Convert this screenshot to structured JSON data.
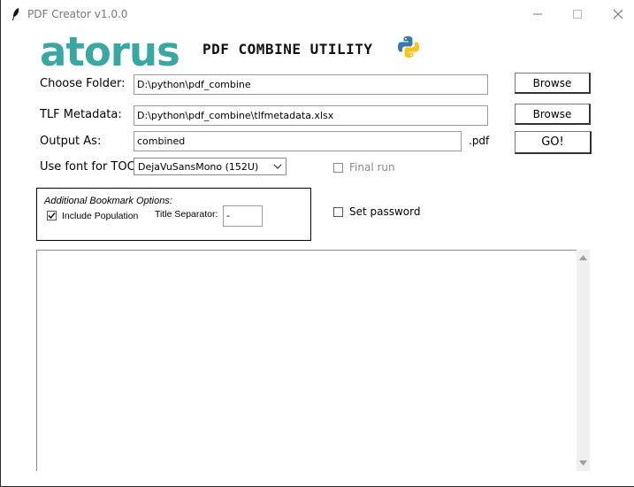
{
  "window": {
    "title": "PDF Creator v1.0.0",
    "icons": {
      "app": "feather-icon",
      "minimize": "minimize-icon",
      "maximize": "maximize-icon",
      "close": "close-icon"
    }
  },
  "header": {
    "logo_text": "atorus",
    "utility_title": "PDF COMBINE UTILITY",
    "python_logo": "python-logo-icon"
  },
  "form": {
    "choose_folder": {
      "label": "Choose Folder:",
      "value": "D:\\python\\pdf_combine",
      "button": "Browse"
    },
    "tlf_metadata": {
      "label": "TLF Metadata:",
      "value": "D:\\python\\pdf_combine\\tlfmetadata.xlsx",
      "button": "Browse"
    },
    "output_as": {
      "label": "Output As:",
      "value": "combined",
      "suffix": ".pdf",
      "button": "GO!"
    },
    "toc_font": {
      "label": "Use font for TOC:",
      "selected": "DejaVuSansMono (152U)"
    },
    "final_run": {
      "label": "Final run",
      "checked": false,
      "enabled": false
    },
    "set_password": {
      "label": "Set password",
      "checked": false
    }
  },
  "bookmark_options": {
    "title": "Additional Bookmark Options:",
    "include_population": {
      "label": "Include Population",
      "checked": true
    },
    "title_separator": {
      "label": "Title Separator:",
      "value": "-"
    }
  },
  "log": {
    "content": ""
  },
  "colors": {
    "logo": "#2a8c8c",
    "logo_dark": "#1e3a40",
    "python_blue": "#3b77a8",
    "python_yellow": "#f5c518"
  }
}
